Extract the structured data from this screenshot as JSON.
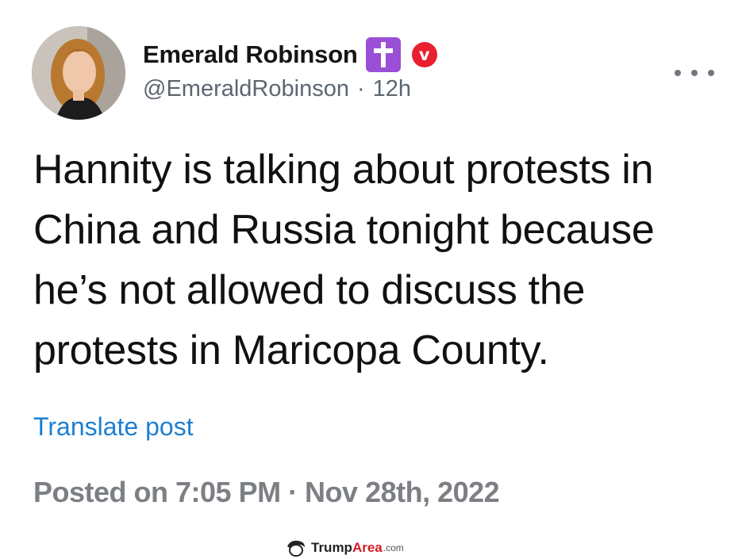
{
  "author": {
    "display_name": "Emerald Robinson",
    "handle": "@EmeraldRobinson",
    "separator": "·",
    "time_ago": "12h",
    "badge_cross_icon": "latin-cross-icon",
    "badge_verified_icon": "v-verified-icon",
    "badge_verified_letter": "v",
    "badge_cross_color": "#9a4fd6",
    "badge_verified_color": "#e8202f"
  },
  "post": {
    "lines": [
      "Hannity is talking about protests in",
      "China and Russia tonight because",
      "he’s not allowed to discuss the",
      "protests in Maricopa County."
    ],
    "translate_label": "Translate post",
    "posted_label": "Posted on 7:05 PM · Nov 28th, 2022"
  },
  "actions": {
    "more_icon": "more-horizontal-icon"
  },
  "watermark": {
    "part1": "Trump",
    "part2": "Area",
    "part3": ".com"
  },
  "colors": {
    "link": "#1d7fd1",
    "muted": "#5c6670"
  }
}
